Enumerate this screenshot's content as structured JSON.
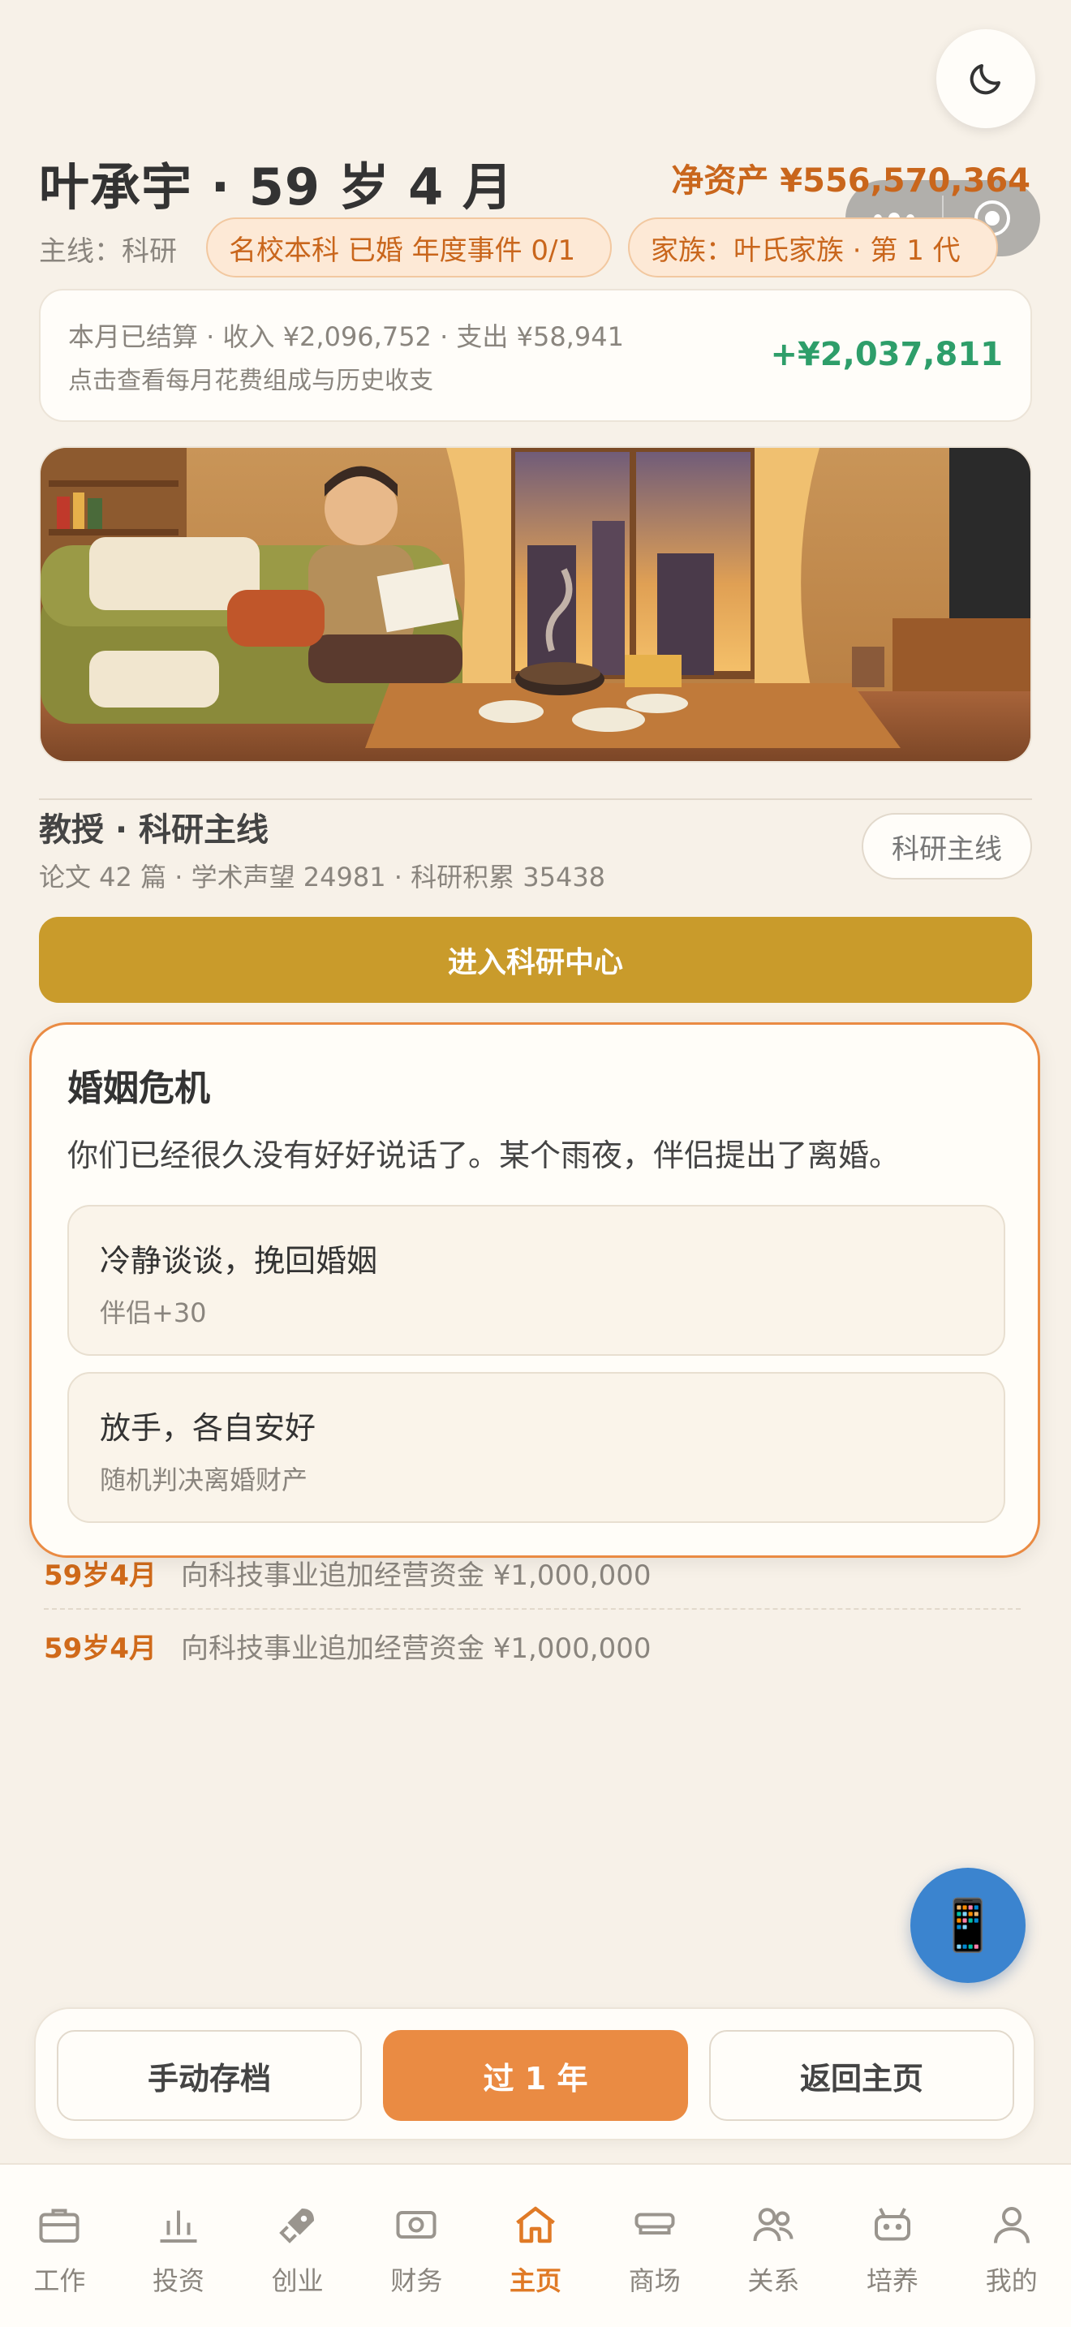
{
  "header": {
    "title": "叶承宇 · 59 岁 4 月",
    "net_worth": "净资产 ¥556,570,364",
    "mainline": "主线：科研",
    "tag_status": "名校本科 已婚 年度事件 0/1",
    "tag_family": "家族：叶氏家族 · 第 1 代"
  },
  "settlement": {
    "line1": "本月已结算 · 收入 ¥2,096,752 · 支出 ¥58,941",
    "line2": "点击查看每月花费组成与历史收支",
    "net": "+¥2,037,811"
  },
  "career": {
    "title": "教授 · 科研主线",
    "stats": "论文 42 篇 · 学术声望 24981 · 科研积累 35438",
    "pill": "科研主线",
    "enter_button": "进入科研中心"
  },
  "modal": {
    "title": "婚姻危机",
    "text": "你们已经很久没有好好说话了。某个雨夜，伴侣提出了离婚。",
    "choices": [
      {
        "title": "冷静谈谈，挽回婚姻",
        "sub": "伴侣+30"
      },
      {
        "title": "放手，各自安好",
        "sub": "随机判决离婚财产"
      }
    ]
  },
  "log": [
    {
      "when": "59岁4月",
      "text": "向科技事业追加经营资金 ¥1,000,000"
    },
    {
      "when": "59岁4月",
      "text": "向科技事业追加经营资金 ¥1,000,000"
    }
  ],
  "actions": {
    "save": "手动存档",
    "advance": "过 1 年",
    "home": "返回主页"
  },
  "fab_icon": "📱",
  "tabs": [
    {
      "label": "工作",
      "icon": "briefcase-icon"
    },
    {
      "label": "投资",
      "icon": "chart-icon"
    },
    {
      "label": "创业",
      "icon": "rocket-icon"
    },
    {
      "label": "财务",
      "icon": "money-icon"
    },
    {
      "label": "主页",
      "icon": "home-icon"
    },
    {
      "label": "商场",
      "icon": "store-icon"
    },
    {
      "label": "关系",
      "icon": "people-icon"
    },
    {
      "label": "培养",
      "icon": "robot-icon"
    },
    {
      "label": "我的",
      "icon": "user-icon"
    }
  ],
  "colors": {
    "accent": "#ea8b43",
    "gold": "#c99b2b",
    "positive": "#2e9e6a",
    "background": "#f7f1e8"
  }
}
